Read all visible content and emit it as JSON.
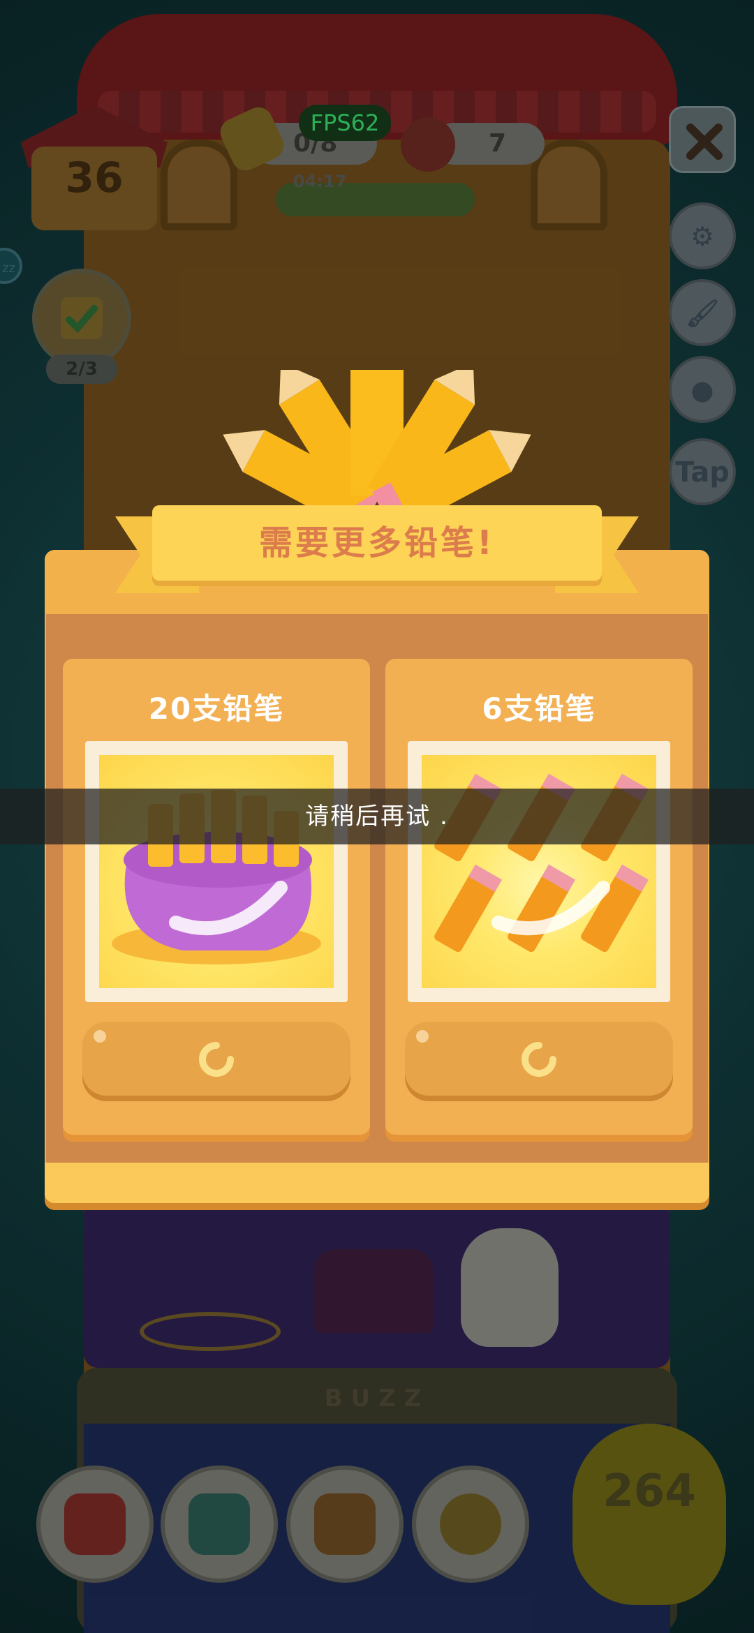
{
  "hud": {
    "level": "36",
    "pencil_progress": "0/8",
    "fps": "FPS62",
    "timer": "04:17",
    "cans": "7",
    "tasks": "2/3",
    "side_buttons": [
      "gear-icon",
      "paint-roller-icon",
      "stamp-icon",
      "Tap"
    ],
    "left_badge": "zz"
  },
  "modal": {
    "title": "需要更多铅笔!",
    "offers": [
      {
        "label": "20支铅笔",
        "quantity": 20
      },
      {
        "label": "6支铅笔",
        "quantity": 6
      }
    ]
  },
  "toast": {
    "message": "请稍后再试 ."
  },
  "floor": {
    "label": "BUZZ"
  },
  "bottom": {
    "buttons": [
      "armchair-icon",
      "paw-book-icon",
      "picture-frame-icon",
      "snow-globe-icon"
    ],
    "coins": "264"
  },
  "colors": {
    "panel": "#f3b14c",
    "ribbon": "#fdd456",
    "title_text": "#dc7c4c",
    "toast_bg": "#1e1e1e"
  }
}
